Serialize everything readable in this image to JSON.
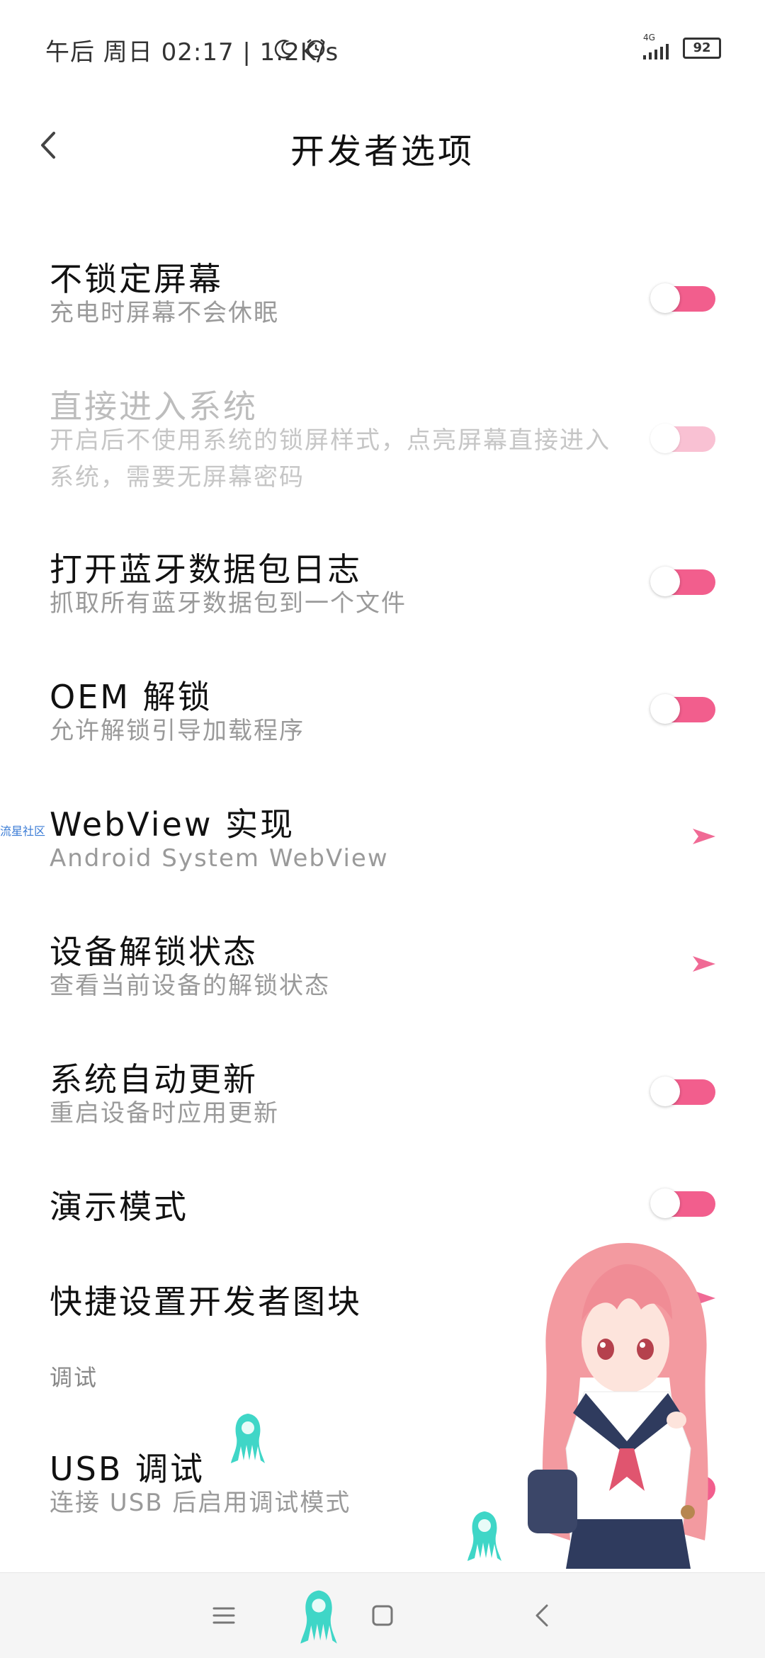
{
  "status_bar": {
    "text": "午后 周日 02:17 | 1.2K/s",
    "network": "4G",
    "battery": "92"
  },
  "header": {
    "title": "开发者选项",
    "back_icon": "chevron-left-icon"
  },
  "colors": {
    "accent": "#f25e8d",
    "accent_disabled": "#f9c1d3",
    "arrow": "#f06a95"
  },
  "rows": [
    {
      "title": "不锁定屏幕",
      "subtitle": "充电时屏幕不会休眠",
      "control": "toggle",
      "on": true,
      "enabled": true
    },
    {
      "title": "直接进入系统",
      "subtitle": "开启后不使用系统的锁屏样式，点亮屏幕直接进入系统，需要无屏幕密码",
      "control": "toggle",
      "on": true,
      "enabled": false
    },
    {
      "title": "打开蓝牙数据包日志",
      "subtitle": "抓取所有蓝牙数据包到一个文件",
      "control": "toggle",
      "on": true,
      "enabled": true
    },
    {
      "title": "OEM 解锁",
      "subtitle": "允许解锁引导加载程序",
      "control": "toggle",
      "on": true,
      "enabled": true
    },
    {
      "title": "WebView 实现",
      "subtitle": "Android System WebView",
      "control": "arrow",
      "enabled": true
    },
    {
      "title": "设备解锁状态",
      "subtitle": "查看当前设备的解锁状态",
      "control": "arrow",
      "enabled": true
    },
    {
      "title": "系统自动更新",
      "subtitle": "重启设备时应用更新",
      "control": "toggle",
      "on": true,
      "enabled": true
    },
    {
      "title": "演示模式",
      "subtitle": "",
      "control": "toggle",
      "on": true,
      "enabled": true
    },
    {
      "title": "快捷设置开发者图块",
      "subtitle": "",
      "control": "arrow",
      "enabled": true
    }
  ],
  "section": {
    "label": "调试"
  },
  "usb_row": {
    "title": "USB 调试",
    "subtitle": "连接 USB 后启用调试模式",
    "control": "toggle",
    "on": true,
    "enabled": true
  },
  "side_tag": "流星社区",
  "nav_bar": {
    "menu_icon": "menu-icon",
    "home_icon": "home-square-icon",
    "back_icon": "back-triangle-icon"
  }
}
